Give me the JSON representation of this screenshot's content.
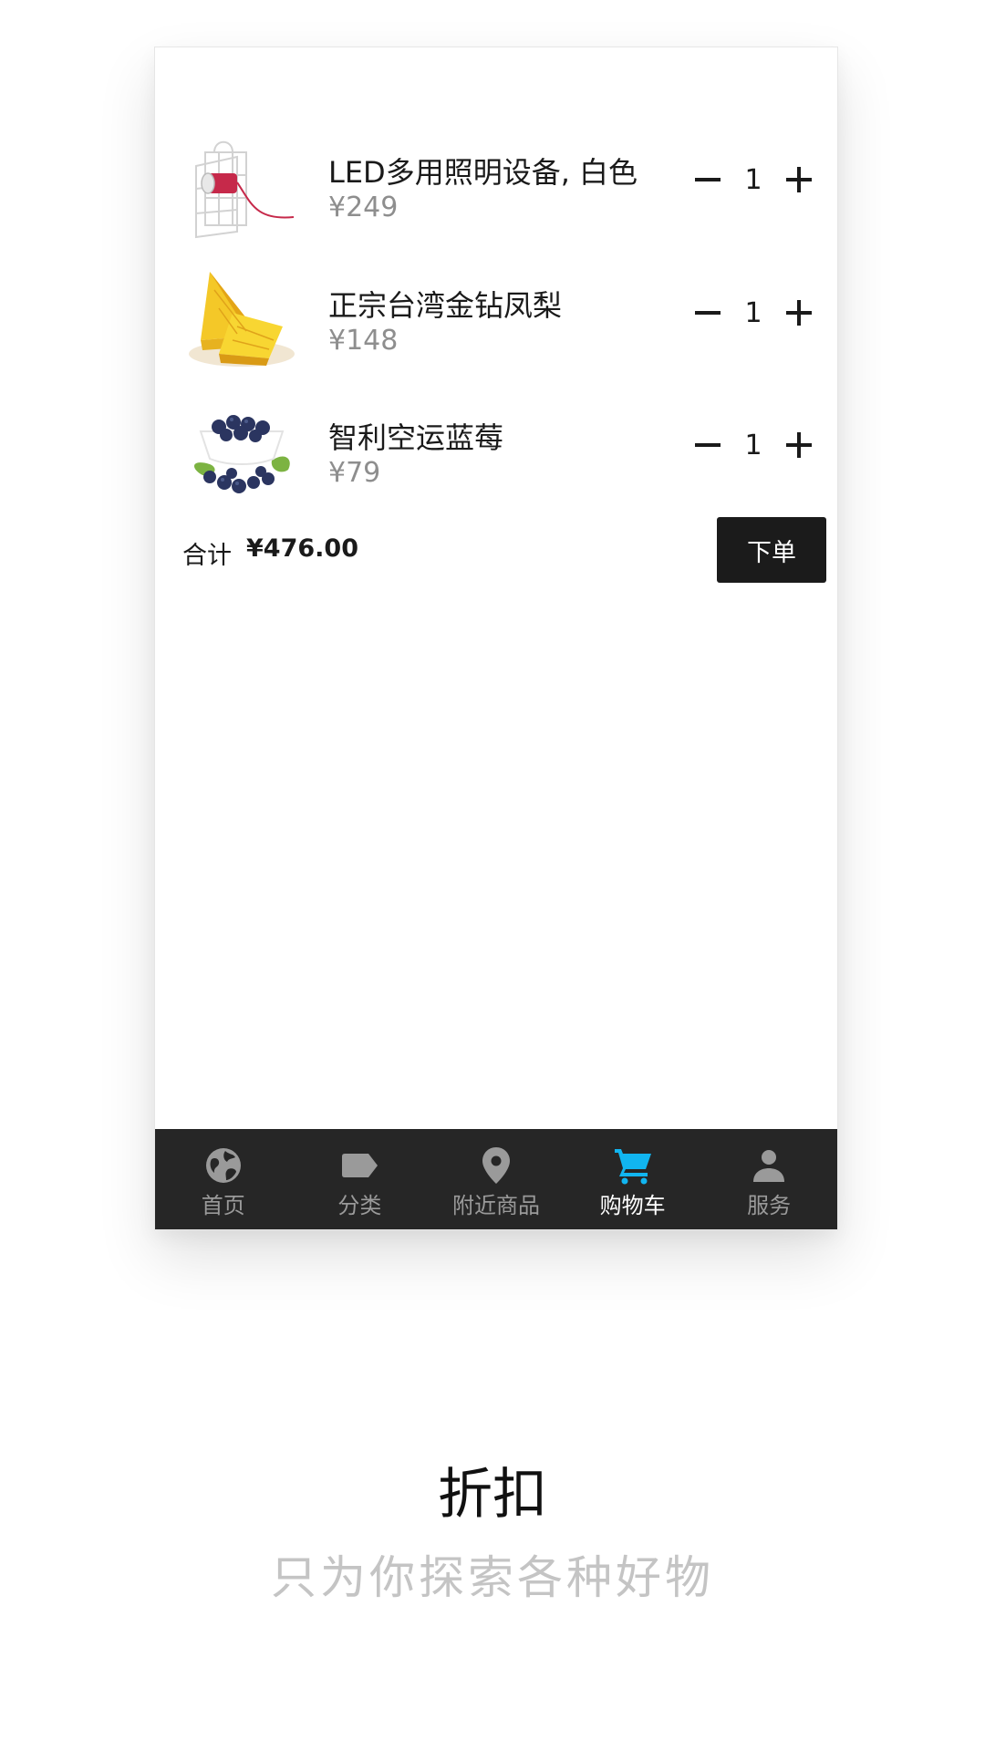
{
  "cart": {
    "items": [
      {
        "name": "LED多用照明设备, 白色",
        "price": "¥249",
        "quantity": "1",
        "image_icon": "lantern-image"
      },
      {
        "name": "正宗台湾金钻凤梨",
        "price": "¥148",
        "quantity": "1",
        "image_icon": "pineapple-image"
      },
      {
        "name": "智利空运蓝莓",
        "price": "¥79",
        "quantity": "1",
        "image_icon": "blueberry-image"
      }
    ],
    "total_label": "合计",
    "total_amount": "¥476.00",
    "order_label": "下单"
  },
  "tab_bar": {
    "active_color": "#11b5f0",
    "inactive_color": "#9a9a9a",
    "tabs": [
      {
        "label": "首页",
        "icon": "globe-icon",
        "active": false
      },
      {
        "label": "分类",
        "icon": "tag-icon",
        "active": false
      },
      {
        "label": "附近商品",
        "icon": "location-pin-icon",
        "active": false
      },
      {
        "label": "购物车",
        "icon": "cart-icon",
        "active": true
      },
      {
        "label": "服务",
        "icon": "person-icon",
        "active": false
      }
    ]
  },
  "promo": {
    "title": "折扣",
    "subtitle": "只为你探索各种好物"
  }
}
